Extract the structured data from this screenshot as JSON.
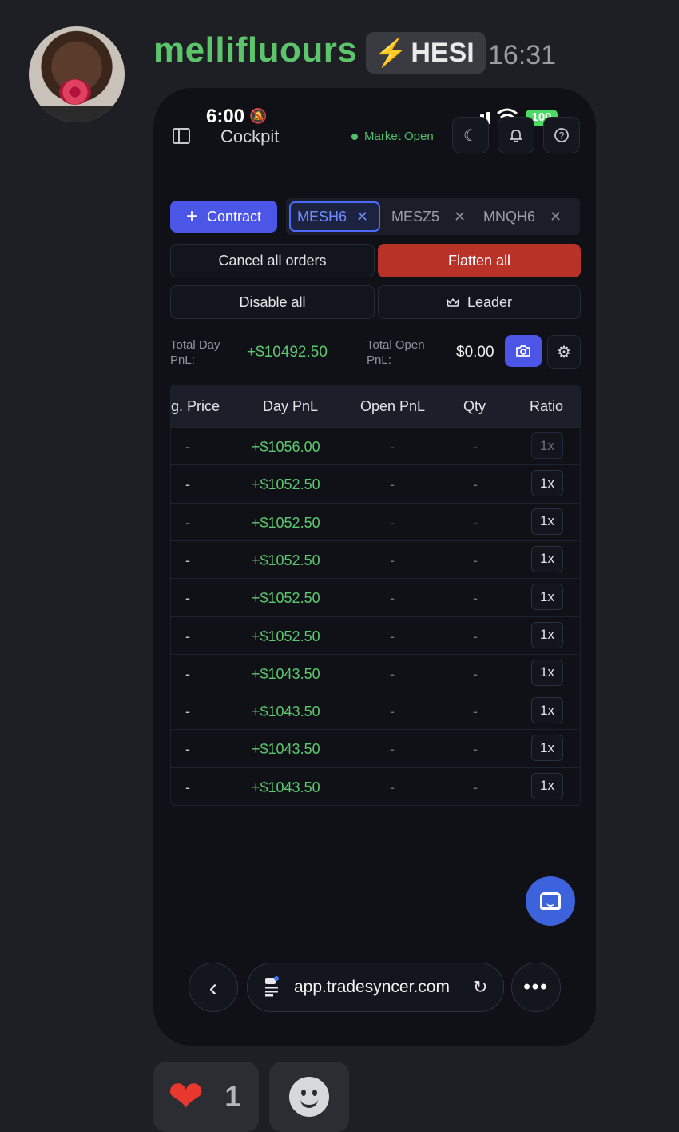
{
  "message": {
    "username": "mellifluours",
    "role_tag": "HESI",
    "timestamp": "16:31"
  },
  "phone": {
    "status_time": "6:00",
    "battery": "100",
    "app_title": "Cockpit",
    "market_status": "Market Open",
    "contract_button": "Contract",
    "contract_tabs": [
      {
        "label": "MESH6",
        "active": true
      },
      {
        "label": "MESZ5",
        "active": false
      },
      {
        "label": "MNQH6",
        "active": false
      }
    ],
    "actions": {
      "cancel_all": "Cancel all orders",
      "flatten_all": "Flatten all",
      "disable_all": "Disable all",
      "leader": "Leader"
    },
    "pnl": {
      "total_day_label": "Total Day PnL:",
      "total_day_value": "+$10492.50",
      "total_open_label": "Total Open PnL:",
      "total_open_value": "$0.00"
    },
    "table": {
      "columns": [
        "g. Price",
        "Day PnL",
        "Open PnL",
        "Qty",
        "Ratio"
      ],
      "rows": [
        {
          "price": "-",
          "day_pnl": "+$1056.00",
          "open_pnl": "-",
          "qty": "-",
          "ratio": "1x"
        },
        {
          "price": "-",
          "day_pnl": "+$1052.50",
          "open_pnl": "-",
          "qty": "-",
          "ratio": "1x"
        },
        {
          "price": "-",
          "day_pnl": "+$1052.50",
          "open_pnl": "-",
          "qty": "-",
          "ratio": "1x"
        },
        {
          "price": "-",
          "day_pnl": "+$1052.50",
          "open_pnl": "-",
          "qty": "-",
          "ratio": "1x"
        },
        {
          "price": "-",
          "day_pnl": "+$1052.50",
          "open_pnl": "-",
          "qty": "-",
          "ratio": "1x"
        },
        {
          "price": "-",
          "day_pnl": "+$1052.50",
          "open_pnl": "-",
          "qty": "-",
          "ratio": "1x"
        },
        {
          "price": "-",
          "day_pnl": "+$1043.50",
          "open_pnl": "-",
          "qty": "-",
          "ratio": "1x"
        },
        {
          "price": "-",
          "day_pnl": "+$1043.50",
          "open_pnl": "-",
          "qty": "-",
          "ratio": "1x"
        },
        {
          "price": "-",
          "day_pnl": "+$1043.50",
          "open_pnl": "-",
          "qty": "-",
          "ratio": "1x"
        },
        {
          "price": "-",
          "day_pnl": "+$1043.50",
          "open_pnl": "-",
          "qty": "-",
          "ratio": "1x"
        }
      ]
    },
    "browser": {
      "url": "app.tradesyncer.com"
    }
  },
  "reactions": {
    "heart_count": "1"
  },
  "colors": {
    "username": "#5cc46b",
    "accent": "#4b55e6",
    "danger": "#b83228",
    "profit": "#5dc96f"
  }
}
